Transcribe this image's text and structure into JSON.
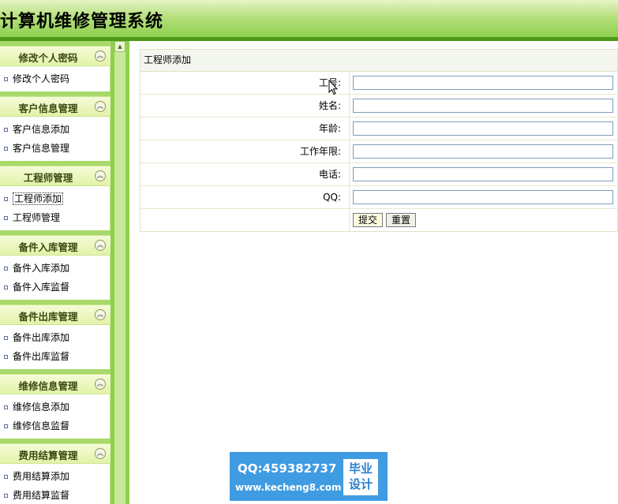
{
  "app": {
    "title": "计算机维修管理系统"
  },
  "sidebar": {
    "groups": [
      {
        "title": "修改个人密码",
        "items": [
          "修改个人密码"
        ]
      },
      {
        "title": "客户信息管理",
        "items": [
          "客户信息添加",
          "客户信息管理"
        ]
      },
      {
        "title": "工程师管理",
        "items": [
          "工程师添加",
          "工程师管理"
        ]
      },
      {
        "title": "备件入库管理",
        "items": [
          "备件入库添加",
          "备件入库监督"
        ]
      },
      {
        "title": "备件出库管理",
        "items": [
          "备件出库添加",
          "备件出库监督"
        ]
      },
      {
        "title": "维修信息管理",
        "items": [
          "维修信息添加",
          "维修信息监督"
        ]
      },
      {
        "title": "费用结算管理",
        "items": [
          "费用结算添加",
          "费用结算监督"
        ]
      }
    ],
    "active_item": "工程师添加"
  },
  "form": {
    "title": "工程师添加",
    "fields": [
      {
        "label": "工号:",
        "value": ""
      },
      {
        "label": "姓名:",
        "value": ""
      },
      {
        "label": "年龄:",
        "value": ""
      },
      {
        "label": "工作年限:",
        "value": ""
      },
      {
        "label": "电话:",
        "value": ""
      },
      {
        "label": "QQ:",
        "value": ""
      }
    ],
    "submit_label": "提交",
    "reset_label": "重置"
  },
  "watermark": {
    "qq": "QQ:459382737",
    "url": "www.kecheng8.com",
    "badge_line1": "毕业",
    "badge_line2": "设计"
  }
}
